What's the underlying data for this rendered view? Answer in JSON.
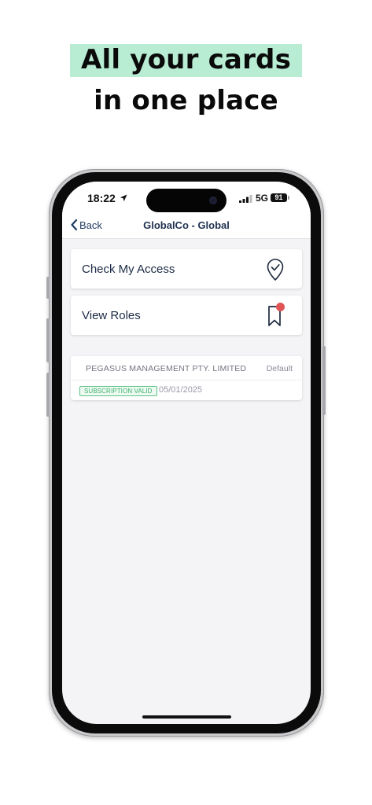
{
  "headline": {
    "line1": "All your cards",
    "line2": "in one place"
  },
  "status_bar": {
    "time": "18:22",
    "network": "5G",
    "battery": "91"
  },
  "nav": {
    "back_label": "Back",
    "title": "GlobalCo - Global"
  },
  "actions": [
    {
      "label": "Check My Access",
      "icon": "location-check-icon"
    },
    {
      "label": "View Roles",
      "icon": "bookmark-icon",
      "has_notification": true
    }
  ],
  "organization": {
    "name": "PEGASUS MANAGEMENT PTY. LIMITED",
    "tag": "Default",
    "status": "SUBSCRIPTION VALID",
    "date": "05/01/2025"
  },
  "colors": {
    "highlight": "#b8ecd3",
    "primary_text": "#1b2a44",
    "status_green": "#3bb36a",
    "notification_red": "#e05454"
  }
}
